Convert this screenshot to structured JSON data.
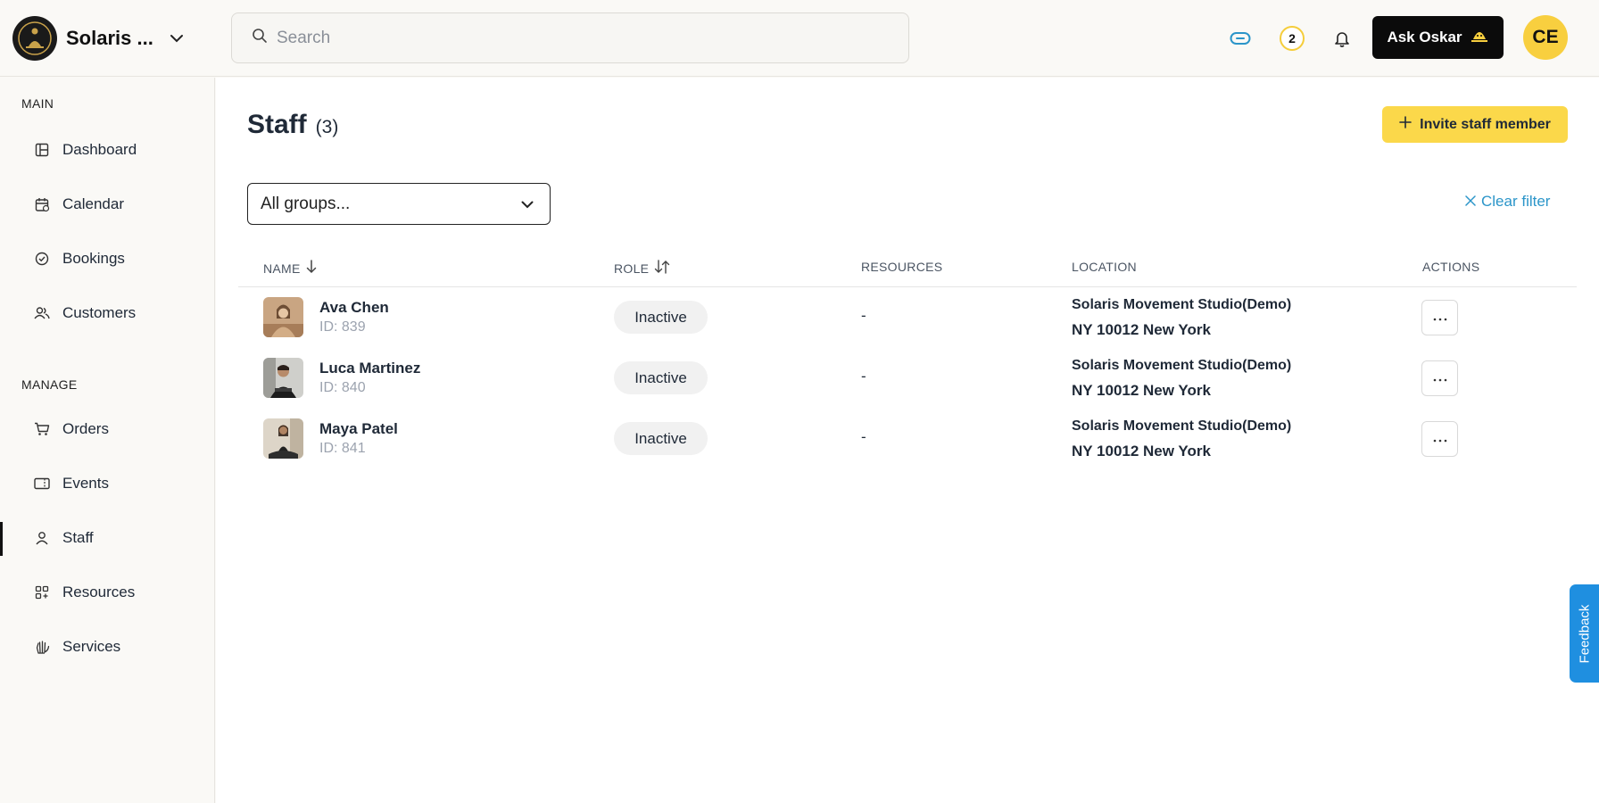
{
  "header": {
    "org_name": "Solaris ...",
    "search_placeholder": "Search",
    "notification_count": "2",
    "ask_label": "Ask Oskar",
    "user_initials": "CE"
  },
  "sidebar": {
    "main_title": "MAIN",
    "main_items": [
      {
        "label": "Dashboard",
        "icon": "dashboard-icon"
      },
      {
        "label": "Calendar",
        "icon": "calendar-icon"
      },
      {
        "label": "Bookings",
        "icon": "bookings-icon"
      },
      {
        "label": "Customers",
        "icon": "customers-icon"
      }
    ],
    "manage_title": "MANAGE",
    "manage_items": [
      {
        "label": "Orders",
        "icon": "cart-icon"
      },
      {
        "label": "Events",
        "icon": "ticket-icon"
      },
      {
        "label": "Staff",
        "icon": "user-icon",
        "active": true
      },
      {
        "label": "Resources",
        "icon": "resources-icon"
      },
      {
        "label": "Services",
        "icon": "services-icon"
      }
    ]
  },
  "page": {
    "title": "Staff",
    "count": "(3)",
    "invite_label": "Invite staff member",
    "group_select_value": "All groups...",
    "clear_filter_label": "Clear filter"
  },
  "table": {
    "columns": [
      "NAME",
      "ROLE",
      "RESOURCES",
      "LOCATION",
      "ACTIONS"
    ],
    "rows": [
      {
        "name": "Ava Chen",
        "id": "ID: 839",
        "role": "Inactive",
        "resources": "-",
        "location_line1": "Solaris Movement Studio(Demo)",
        "location_line2": "NY 10012 New York"
      },
      {
        "name": "Luca Martinez",
        "id": "ID: 840",
        "role": "Inactive",
        "resources": "-",
        "location_line1": "Solaris Movement Studio(Demo)",
        "location_line2": "NY 10012 New York"
      },
      {
        "name": "Maya Patel",
        "id": "ID: 841",
        "role": "Inactive",
        "resources": "-",
        "location_line1": "Solaris Movement Studio(Demo)",
        "location_line2": "NY 10012 New York"
      }
    ]
  },
  "feedback_label": "Feedback",
  "colors": {
    "accent_yellow": "#fbd84a",
    "link_blue": "#2b95c9",
    "feedback_blue": "#1f8fe0"
  }
}
